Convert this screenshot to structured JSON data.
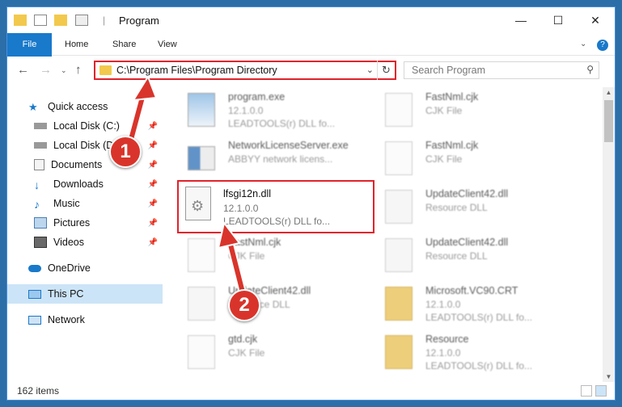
{
  "window": {
    "title": "Program"
  },
  "ribbon": {
    "tabs": [
      "File",
      "Home",
      "Share",
      "View"
    ]
  },
  "address": {
    "path": "C:\\Program Files\\Program Directory"
  },
  "search": {
    "placeholder": "Search Program"
  },
  "nav": {
    "items": [
      {
        "label": "Quick access",
        "icon": "star-icon"
      },
      {
        "label": "Local Disk (C:)",
        "icon": "drive-icon",
        "pinned": true
      },
      {
        "label": "Local Disk (D:)",
        "icon": "drive-icon",
        "pinned": true
      },
      {
        "label": "Documents",
        "icon": "documents-icon",
        "pinned": true
      },
      {
        "label": "Downloads",
        "icon": "downloads-icon",
        "pinned": true
      },
      {
        "label": "Music",
        "icon": "music-icon",
        "pinned": true
      },
      {
        "label": "Pictures",
        "icon": "pictures-icon",
        "pinned": true
      },
      {
        "label": "Videos",
        "icon": "videos-icon",
        "pinned": true
      },
      {
        "label": "OneDrive",
        "icon": "cloud-icon"
      },
      {
        "label": "This PC",
        "icon": "computer-icon",
        "selected": true
      },
      {
        "label": "Network",
        "icon": "network-icon"
      }
    ]
  },
  "files": {
    "left": [
      {
        "name": "program.exe",
        "line1": "12.1.0.0",
        "line2": "LEADTOOLS(r) DLL fo..."
      },
      {
        "name": "NetworkLicenseServer.exe",
        "line1": "ABBYY network licens..."
      },
      {
        "name": "lfsgi12n.dll",
        "line1": "12.1.0.0",
        "line2": "LEADTOOLS(r) DLL fo..."
      },
      {
        "name": "FastNml.cjk",
        "line1": "CJK File"
      },
      {
        "name": "UpdateClient42.dll",
        "line1": "Resource DLL"
      },
      {
        "name": "gtd.cjk",
        "line1": "CJK File"
      }
    ],
    "right": [
      {
        "name": "FastNml.cjk",
        "line1": "CJK File"
      },
      {
        "name": "FastNml.cjk",
        "line1": "CJK File"
      },
      {
        "name": "UpdateClient42.dll",
        "line1": "Resource DLL"
      },
      {
        "name": "UpdateClient42.dll",
        "line1": "Resource DLL"
      },
      {
        "name": "Microsoft.VC90.CRT",
        "line1": "12.1.0.0",
        "line2": "LEADTOOLS(r) DLL fo..."
      },
      {
        "name": "Resource",
        "line1": "12.1.0.0",
        "line2": "LEADTOOLS(r) DLL fo..."
      }
    ]
  },
  "status": {
    "count": "162 items"
  },
  "steps": [
    "1",
    "2"
  ],
  "colors": {
    "accent": "#1979ca",
    "highlight": "#e0222b",
    "selected": "#cce4f7"
  }
}
